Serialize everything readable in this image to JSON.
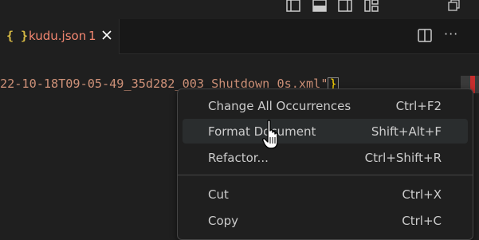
{
  "tab": {
    "icon_text": "{ }",
    "name": "kudu.json",
    "problem_count": "1"
  },
  "editor": {
    "code_text": "22-10-18T09-05-49_35d282_003_Shutdown_0s.xml\"",
    "bracket": "}"
  },
  "context_menu": {
    "items": [
      {
        "label": "Change All Occurrences",
        "shortcut": "Ctrl+F2"
      },
      {
        "label": "Format Document",
        "shortcut": "Shift+Alt+F"
      },
      {
        "label": "Refactor...",
        "shortcut": "Ctrl+Shift+R"
      },
      {
        "label": "Cut",
        "shortcut": "Ctrl+X"
      },
      {
        "label": "Copy",
        "shortcut": "Ctrl+C"
      }
    ]
  },
  "colors": {
    "background": "#1f1f1f",
    "menu_bg": "#1f1f1f",
    "hover_bg": "#2a2d2e",
    "tab_error": "#f48771",
    "braces": "#d7ba44",
    "string": "#ce9178"
  }
}
